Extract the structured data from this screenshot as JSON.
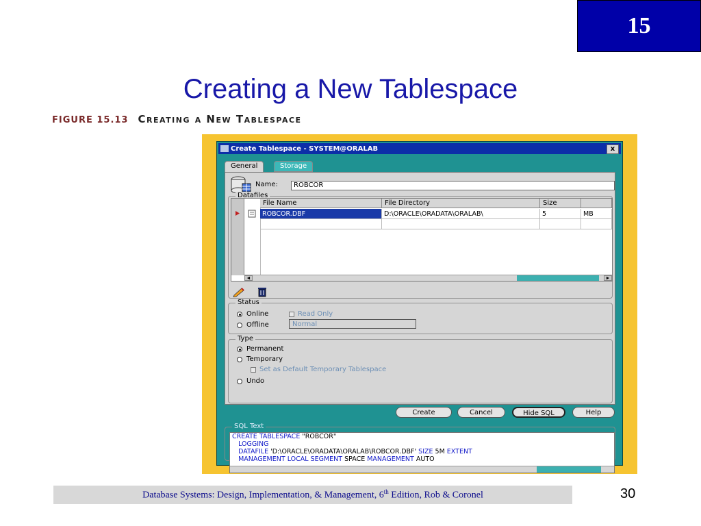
{
  "slide": {
    "chapter_number": "15",
    "title": "Creating a New Tablespace",
    "figure_label": "FIGURE 15.13",
    "figure_title": "Creating a New Tablespace",
    "footer_pre": "Database Systems: Design, Implementation, & Management, 6",
    "footer_sup": "th",
    "footer_post": " Edition, Rob & Coronel",
    "page_number": "30"
  },
  "window": {
    "title": "Create Tablespace - SYSTEM@ORALAB",
    "close_label": "x",
    "tabs": [
      "General",
      "Storage"
    ],
    "name_label": "Name:",
    "name_value": "ROBCOR",
    "datafiles_label": "Datafiles",
    "grid": {
      "columns": [
        "File Name",
        "File Directory",
        "Size"
      ],
      "rows": [
        {
          "file_name": "ROBCOR.DBF",
          "file_directory": "D:\\ORACLE\\ORADATA\\ORALAB\\",
          "size": "5",
          "unit": "MB"
        }
      ]
    },
    "status": {
      "label": "Status",
      "online": "Online",
      "offline": "Offline",
      "read_only": "Read Only",
      "mode_value": "Normal"
    },
    "type": {
      "label": "Type",
      "permanent": "Permanent",
      "temporary": "Temporary",
      "default_temp": "Set as Default Temporary Tablespace",
      "undo": "Undo"
    },
    "buttons": {
      "create": "Create",
      "cancel": "Cancel",
      "hide_sql": "Hide SQL",
      "help": "Help"
    },
    "sql": {
      "label": "SQL Text",
      "kw_create": "CREATE TABLESPACE",
      "name_literal": " \"ROBCOR\"",
      "kw_logging": "LOGGING",
      "kw_datafile": "DATAFILE",
      "path_literal": " 'D:\\ORACLE\\ORADATA\\ORALAB\\ROBCOR.DBF'",
      "kw_size": " SIZE",
      "size_value": " 5M",
      "kw_extent": " EXTENT",
      "kw_mgmt_local": "MANAGEMENT LOCAL SEGMENT",
      "space_word": " SPACE",
      "kw_management": " MANAGEMENT",
      "auto_word": " AUTO"
    }
  },
  "colors": {
    "chapter_box": "#0000a8",
    "title": "#1818a8",
    "frame": "#f6c431",
    "window_body": "#1f9292",
    "titlebar": "#0c2ea8",
    "selection": "#1a3aa8",
    "sql_keyword": "#1018c8"
  }
}
